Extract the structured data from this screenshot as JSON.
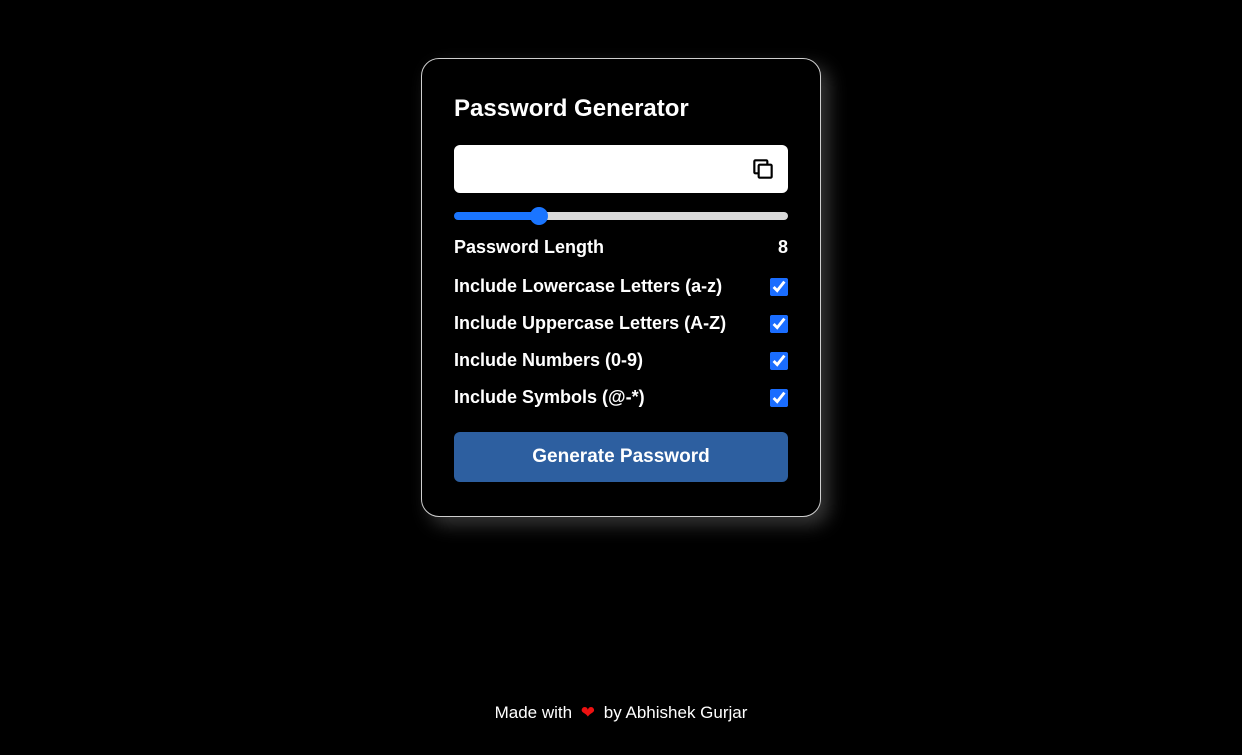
{
  "title": "Password Generator",
  "output": {
    "value": "",
    "placeholder": ""
  },
  "slider": {
    "min": 1,
    "max": 30,
    "value": 8
  },
  "length": {
    "label": "Password Length",
    "value": "8"
  },
  "options": {
    "lowercase": {
      "label": "Include Lowercase Letters (a-z)",
      "checked": true
    },
    "uppercase": {
      "label": "Include Uppercase Letters (A-Z)",
      "checked": true
    },
    "numbers": {
      "label": "Include Numbers (0-9)",
      "checked": true
    },
    "symbols": {
      "label": "Include Symbols (@-*)",
      "checked": true
    }
  },
  "generate_label": "Generate Password",
  "footer": {
    "prefix": "Made with ",
    "heart": "❤",
    "suffix": " by Abhishek Gurjar"
  }
}
